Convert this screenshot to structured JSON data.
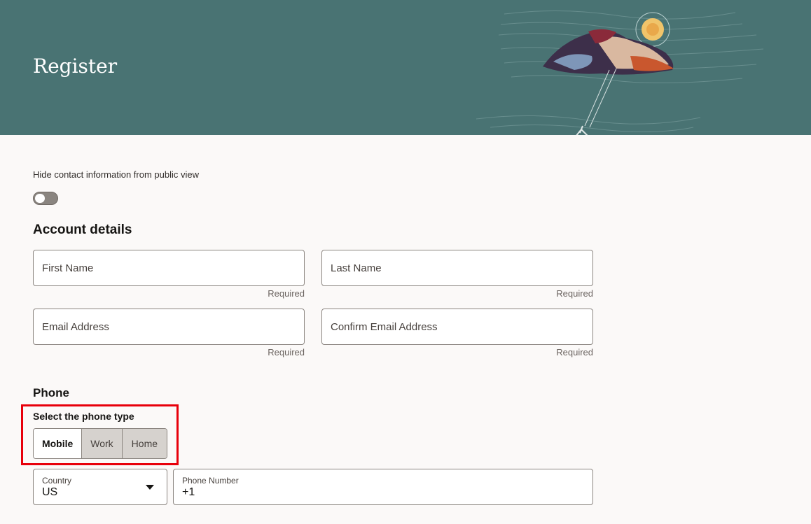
{
  "header": {
    "title": "Register"
  },
  "privacy": {
    "toggle_label": "Hide contact information from public view",
    "toggle_on": false
  },
  "account": {
    "title": "Account details",
    "fields": [
      {
        "label": "First Name",
        "helper": "Required"
      },
      {
        "label": "Last Name",
        "helper": "Required"
      },
      {
        "label": "Email Address",
        "helper": "Required"
      },
      {
        "label": "Confirm Email Address",
        "helper": "Required"
      }
    ]
  },
  "phone": {
    "title": "Phone",
    "type_label": "Select the phone type",
    "types": [
      "Mobile",
      "Work",
      "Home"
    ],
    "selected_type": "Mobile",
    "country_label": "Country",
    "country_value": "US",
    "number_label": "Phone Number",
    "number_value": "+1"
  },
  "colors": {
    "banner": "#497373",
    "highlight": "#e8000b",
    "page_bg": "#fbf9f8"
  }
}
